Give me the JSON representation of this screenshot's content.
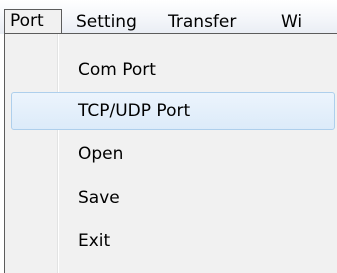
{
  "menubar": {
    "items": [
      {
        "label": "Port"
      },
      {
        "label": "Setting"
      },
      {
        "label": "Transfer"
      },
      {
        "label": "Wi"
      }
    ]
  },
  "port_menu": {
    "items": [
      {
        "label": "Com Port"
      },
      {
        "label": "TCP/UDP Port",
        "highlighted": true
      },
      {
        "label": "Open"
      },
      {
        "label": "Save"
      },
      {
        "label": "Exit"
      }
    ]
  }
}
